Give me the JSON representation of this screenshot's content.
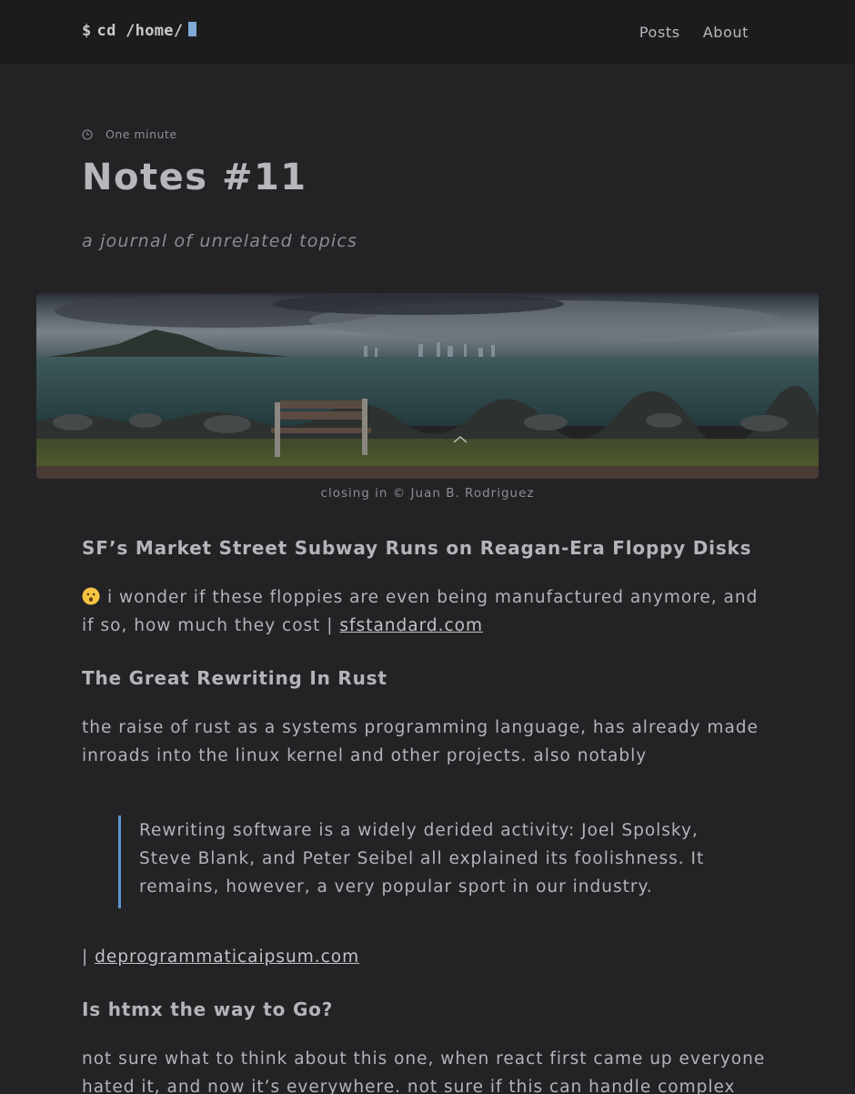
{
  "header": {
    "brand_prompt": "$",
    "brand_text": "cd /home/",
    "nav": [
      {
        "label": "Posts"
      },
      {
        "label": "About"
      }
    ]
  },
  "post": {
    "reading_time": "One minute",
    "title": "Notes #11",
    "subtitle": "a journal of unrelated topics",
    "image_caption": "closing in © Juan B. Rodriguez"
  },
  "sections": [
    {
      "heading": "SF’s Market Street Subway Runs on Reagan-Era Floppy Disks",
      "emoji": "hushed-face",
      "text": "i wonder if these floppies are even being manufactured anymore, and if so, how much they cost | ",
      "link": "sfstandard.com"
    },
    {
      "heading": "The Great Rewriting In Rust",
      "text": "the raise of rust as a systems programming language, has already made inroads into the linux kernel and other projects. also notably",
      "quote": "Rewriting software is a widely derided activity: Joel Spolsky, Steve Blank, and Peter Seibel all explained its foolishness. It remains, however, a very popular sport in our industry.",
      "after_prefix": "| ",
      "link": "deprogrammaticaipsum.com"
    },
    {
      "heading": "Is htmx the way to Go?",
      "text": "not sure what to think about this one, when react first came up everyone hated it, and now it’s everywhere. not sure if this can handle complex uis, we’ll see"
    }
  ],
  "icons": {
    "clock": "clock-icon",
    "scroll_up": "chevron-up-icon"
  },
  "colors": {
    "background": "#232326",
    "header": "#1c1c1e",
    "accent": "#5b93cf",
    "cursor": "#7fa9d9"
  }
}
